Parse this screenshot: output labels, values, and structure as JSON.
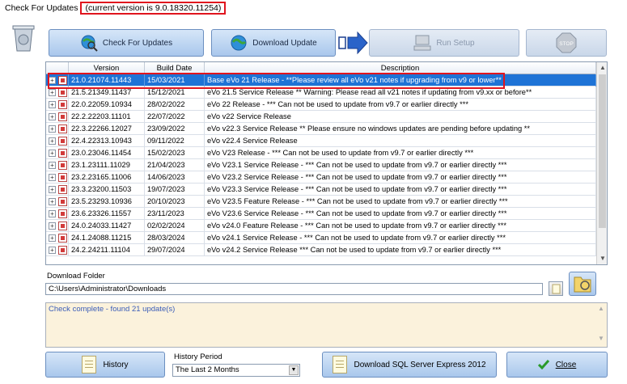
{
  "title": {
    "app_name": "Check For Updates",
    "version_note": "(current version is 9.0.18320.11254)"
  },
  "toolbar": {
    "check_label": "Check For Updates",
    "download_label": "Download Update",
    "run_label": "Run Setup",
    "stop_label": "STOP"
  },
  "grid": {
    "columns": [
      "Version",
      "Build Date",
      "Description"
    ],
    "rows": [
      {
        "version": "21.0.21074.11443",
        "date": "15/03/2021",
        "desc": "Base eVo 21 Release - **Please review all eVo v21 notes if upgrading from v9 or lower**"
      },
      {
        "version": "21.5.21349.11437",
        "date": "15/12/2021",
        "desc": "eVo 21.5 Service Release ** Warning: Please read all v21 notes if updating from v9.xx or before**"
      },
      {
        "version": "22.0.22059.10934",
        "date": "28/02/2022",
        "desc": "eVo 22 Release - *** Can not be used to update from v9.7 or earlier directly ***"
      },
      {
        "version": "22.2.22203.11101",
        "date": "22/07/2022",
        "desc": "eVo v22 Service Release"
      },
      {
        "version": "22.3.22266.12027",
        "date": "23/09/2022",
        "desc": "eVo v22.3 Service Release ** Please ensure no windows updates are pending before updating **"
      },
      {
        "version": "22.4.22313.10943",
        "date": "09/11/2022",
        "desc": "eVo v22.4 Service Release"
      },
      {
        "version": "23.0.23046.11454",
        "date": "15/02/2023",
        "desc": "eVo V23 Release - *** Can not be used to update from v9.7 or earlier directly ***"
      },
      {
        "version": "23.1.23111.11029",
        "date": "21/04/2023",
        "desc": "eVo V23.1 Service Release - *** Can not be used to update from v9.7 or earlier directly ***"
      },
      {
        "version": "23.2.23165.11006",
        "date": "14/06/2023",
        "desc": "eVo V23.2 Service Release - *** Can not be used to update from v9.7 or earlier directly ***"
      },
      {
        "version": "23.3.23200.11503",
        "date": "19/07/2023",
        "desc": "eVo V23.3 Service Release - *** Can not be used to update from v9.7 or earlier directly ***"
      },
      {
        "version": "23.5.23293.10936",
        "date": "20/10/2023",
        "desc": "eVo V23.5 Feature Release - *** Can not be used to update from v9.7 or earlier directly ***"
      },
      {
        "version": "23.6.23326.11557",
        "date": "23/11/2023",
        "desc": "eVo V23.6 Service Release - *** Can not be used to update from v9.7 or earlier directly ***"
      },
      {
        "version": "24.0.24033.11427",
        "date": "02/02/2024",
        "desc": "eVo v24.0 Feature Release - *** Can not be used to update from v9.7 or earlier directly ***"
      },
      {
        "version": "24.1.24088.11215",
        "date": "28/03/2024",
        "desc": "eVo v24.1 Service Release - *** Can not be used to update from v9.7 or earlier directly ***"
      },
      {
        "version": "24.2.24211.11104",
        "date": "29/07/2024",
        "desc": "eVo v24.2 Service Release *** Can not be used to update from v9.7 or earlier directly ***"
      }
    ]
  },
  "download_folder": {
    "label": "Download Folder",
    "path": "C:\\Users\\Administrator\\Downloads"
  },
  "log": {
    "message": "Check complete - found 21 update(s)"
  },
  "bottom": {
    "history_label": "History",
    "history_period_label": "History Period",
    "history_period_value": "The Last 2 Months",
    "sql_label": "Download SQL Server Express 2012",
    "close_label": "Close"
  },
  "colors": {
    "selection": "#1e73d6",
    "highlight_border": "#e0141e",
    "log_background": "#fbf2dc"
  }
}
